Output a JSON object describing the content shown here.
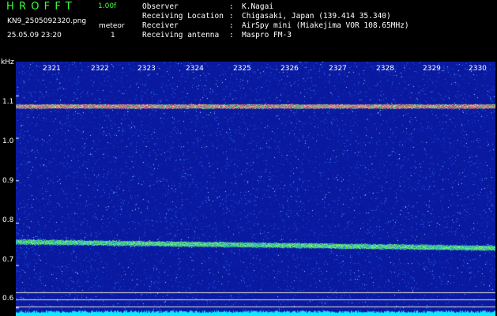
{
  "header": {
    "logo": "HROFFT",
    "version": "1.00f",
    "filename": "KN9_2505092320.png",
    "datetime": "25.05.09 23:20",
    "mode_label": "meteor",
    "mode_value": "1"
  },
  "meta": [
    {
      "key": "Observer",
      "value": "K.Nagai"
    },
    {
      "key": "Receiving Location",
      "value": "Chigasaki, Japan (139.414 35.340)"
    },
    {
      "key": "Receiver",
      "value": "AirSpy mini (Miakejima VOR 108.65MHz)"
    },
    {
      "key": "Receiving antenna",
      "value": "Maspro FM-3"
    }
  ],
  "separator": ":",
  "y_axis": {
    "unit": "kHz",
    "ticks": [
      "1.1",
      "1.0",
      "0.9",
      "0.8",
      "0.7",
      "0.6"
    ],
    "tick_values": [
      1.1,
      1.0,
      0.9,
      0.8,
      0.7,
      0.6
    ],
    "range": [
      0.58,
      1.18
    ]
  },
  "x_axis": {
    "ticks": [
      "2321",
      "2322",
      "2323",
      "2324",
      "2325",
      "2326",
      "2327",
      "2328",
      "2329",
      "2330"
    ]
  },
  "signals": {
    "vor_line_khz": 1.075,
    "carrier_line_khz": 0.75,
    "colors": {
      "background": "#0a1aa0",
      "noise": "#2a6cff",
      "line_a": "#ff7a7a",
      "line_b": "#4cff7a",
      "floor": "#14e6ff",
      "guide": "#e8e0d0"
    }
  }
}
